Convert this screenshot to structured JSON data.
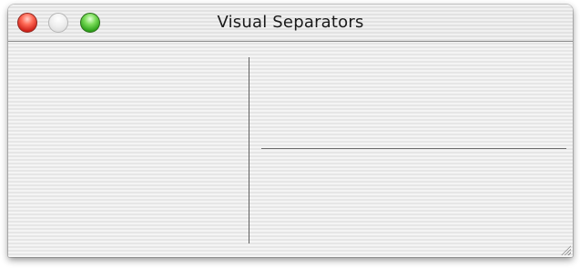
{
  "window": {
    "title": "Visual Separators",
    "traffic_lights": [
      {
        "name": "close",
        "color": "#e0392b"
      },
      {
        "name": "minimize",
        "color": "#e6e6e6"
      },
      {
        "name": "zoom",
        "color": "#45b62a"
      }
    ]
  },
  "content": {
    "separators": [
      {
        "orientation": "vertical"
      },
      {
        "orientation": "horizontal"
      }
    ],
    "resize_grip_icon": "resize-grip-icon"
  }
}
